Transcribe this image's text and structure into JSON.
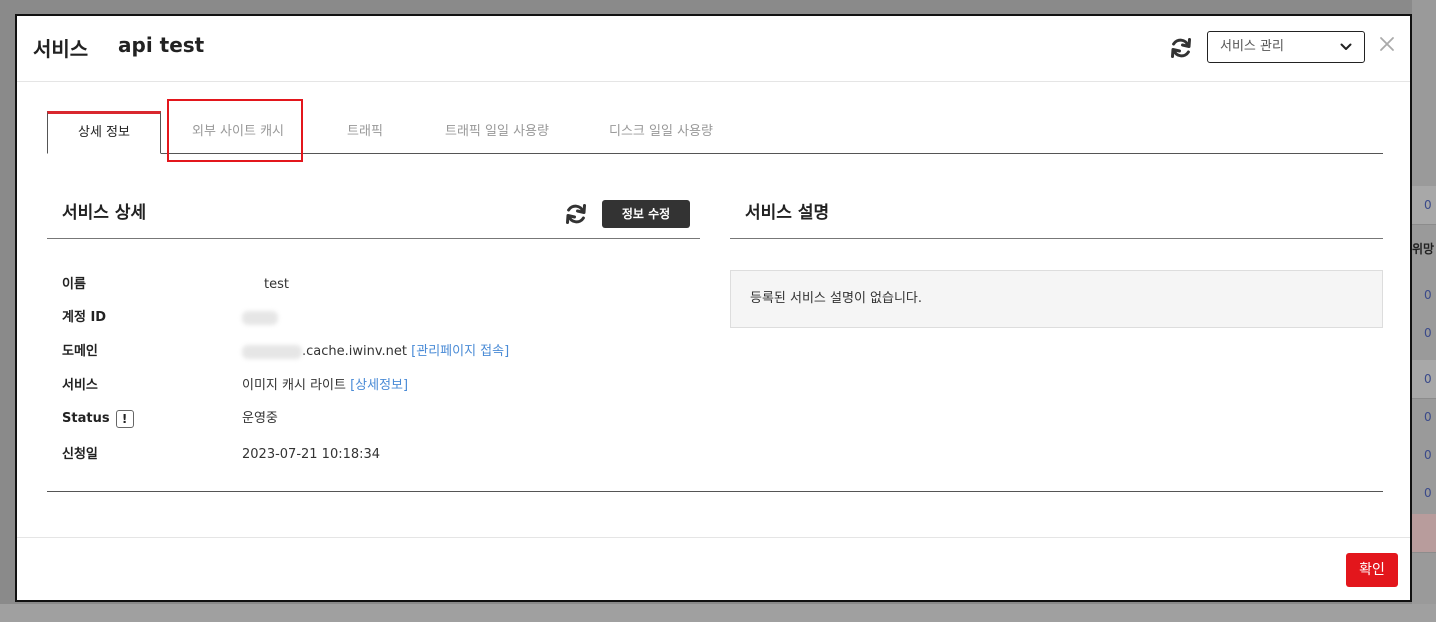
{
  "modal": {
    "title": "서비스",
    "subtitle": "api test",
    "service_select": {
      "value": "서비스 관리"
    },
    "icons": {
      "refresh": "refresh-icon",
      "close": "close-icon",
      "dropdown": "chevron-down-icon"
    }
  },
  "tabs": [
    {
      "label": "상세 정보",
      "active": true
    },
    {
      "label": "외부 사이트 캐시",
      "active": false
    },
    {
      "label": "트래픽",
      "active": false
    },
    {
      "label": "트래픽 일일 사용량",
      "active": false
    },
    {
      "label": "디스크 일일 사용량",
      "active": false
    }
  ],
  "detail": {
    "title": "서비스 상세",
    "edit_label": "정보 수정",
    "rows": [
      {
        "label": "이름",
        "value": "test"
      },
      {
        "label": "계정 ID",
        "value": ""
      },
      {
        "label": "도메인",
        "value": ".cache.iwinv.net",
        "link": "[관리페이지 접속]"
      },
      {
        "label": "서비스",
        "value": "이미지 캐시 라이트",
        "link": "[상세정보]"
      },
      {
        "label": "Status",
        "value": "운영중",
        "icon_text": "!"
      },
      {
        "label": "신청일",
        "value": "2023-07-21 10:18:34"
      }
    ]
  },
  "description": {
    "title": "서비스 설명",
    "text": "등록된 서비스 설명이 없습니다."
  },
  "footer": {
    "confirm_label": "확인"
  },
  "colors": {
    "accent": "#e3161c",
    "link": "#4a8bd6",
    "dark_button": "#333333"
  },
  "backdrop": {
    "cells": [
      "0",
      "위망",
      "0",
      "0",
      "0",
      "0",
      "0",
      "0"
    ]
  }
}
